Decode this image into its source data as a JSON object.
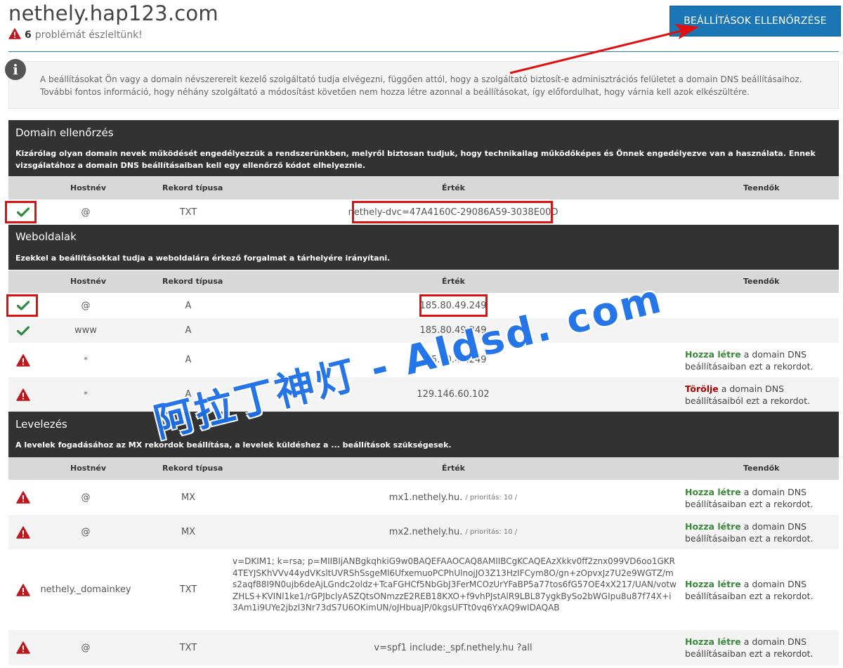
{
  "header": {
    "domain": "nethely.hap123.com",
    "problem_count": "6",
    "problem_text": "problémát észleltünk!",
    "check_button": "BEÁLLÍTÁSOK ELLENŐRZÉSE"
  },
  "info": {
    "text": "A beállításokat Ön vagy a domain névszerereit kezelő szolgáltató tudja elvégezni, függően attól, hogy a szolgáltató biztosít-e adminisztrációs felületet a domain DNS beállításaihoz. További fontos információ, hogy néhány szolgáltató a módosítást követően nem hozza létre azonnal a beállításokat, így előfordulhat, hogy várnia kell azok elkészültére."
  },
  "columns": {
    "host": "Hostnév",
    "type": "Rekord típusa",
    "value": "Érték",
    "todo": "Teendők"
  },
  "todo_text": {
    "create_link": "Hozza létre",
    "create_rest": " a domain DNS beállításaiban ezt a rekordot.",
    "delete_link": "Törölje",
    "delete_rest": " a domain DNS beállításaiból ezt a rekordot."
  },
  "sections": [
    {
      "title": "Domain ellenőrzés",
      "desc": "Kizárólag olyan domain nevek működését engedélyezzük a rendszerünkben, melyről biztosan tudjuk, hogy technikailag működőképes és Önnek engedélyezve van a használata. Ennek vizsgálatához a domain DNS beállításaiban kell egy ellenőrző kódot elhelyeznie.",
      "rows": [
        {
          "status": "ok",
          "host": "@",
          "type": "TXT",
          "value": "nethely-dvc=47A4160C-29086A59-3038E00D"
        }
      ]
    },
    {
      "title": "Weboldalak",
      "desc": "Ezekkel a beállításokkal tudja a weboldalára érkező forgalmat a tárhelyére irányítani.",
      "rows": [
        {
          "status": "ok",
          "host": "@",
          "type": "A",
          "value": "185.80.49.249"
        },
        {
          "status": "ok",
          "host": "www",
          "type": "A",
          "value": "185.80.49.249"
        },
        {
          "status": "warn",
          "host": "*",
          "type": "A",
          "value": "185.80.49.249",
          "todo": "create"
        },
        {
          "status": "warn",
          "host": "*",
          "type": "A",
          "value": "129.146.60.102",
          "todo": "delete"
        }
      ]
    },
    {
      "title": "Levelezés",
      "desc": "A levelek fogadásához az MX rekordok beállítása, a levelek küldéshez a ... beállítások szükségesek.",
      "rows": [
        {
          "status": "warn",
          "host": "@",
          "type": "MX",
          "value": "mx1.nethely.hu.",
          "priority": "/ prioritás: 10 /",
          "todo": "create"
        },
        {
          "status": "warn",
          "host": "@",
          "type": "MX",
          "value": "mx2.nethely.hu.",
          "priority": "/ prioritás: 10 /",
          "todo": "create"
        },
        {
          "status": "warn",
          "host": "nethely._domainkey",
          "type": "TXT",
          "value": "v=DKIM1; k=rsa; p=MIIBIjANBgkqhkiG9w0BAQEFAAOCAQ8AMIIBCgKCAQEAzXkkv0ff2znx099VD6oo1GKR4TEYJSKhVVv44ydVKsltUVRShSsgeMl6UfxemuoPCPhUlnojJO3Z13HzIFCym8O/gn+zOpvxJz7U2e9WGTZ/ms2aqf88I9N0ujb6deAjLGndc2oldz+TcaFGHCf5NbGbJ3FerMCOzUrYFaBP5a77tos6fG57OE4xX217/UAN/votwZHLS+KVINl1ke1/rGPJbclyASZQtsONmzzE2REB18KXO+f9vhPJstAlR9LBL87ygkBySo2bWGIpu8u87f74X+i3Am1i9UYe2jbzl3Nr73dS7U6OKimUN/oJHbuaJP/0kgsUFTt0vq6YxAQ9wIDAQAB",
          "todo": "create"
        },
        {
          "status": "warn",
          "host": "@",
          "type": "TXT",
          "value": "v=spf1 include:_spf.nethely.hu ?all",
          "todo": "create"
        }
      ]
    }
  ],
  "watermark": "阿拉丁神灯 - Aldsd. com",
  "colors": {
    "button": "#1a76b4",
    "section_bg": "#323232",
    "ok": "#2e8b3e",
    "warn": "#c0171d",
    "highlight": "#e01010"
  }
}
